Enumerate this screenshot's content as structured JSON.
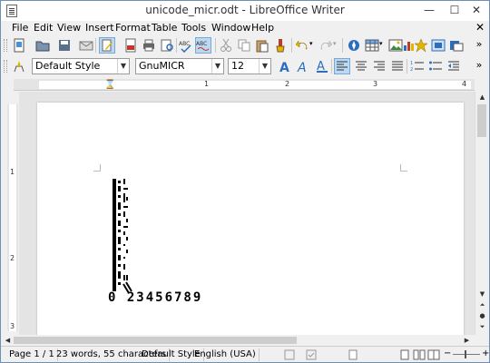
{
  "window": {
    "title": "unicode_micr.odt - LibreOffice Writer",
    "minimize_glyph": "—",
    "maximize_glyph": "☐",
    "close_glyph": "✕"
  },
  "menubar": {
    "items": [
      "File",
      "Edit",
      "View",
      "Insert",
      "Format",
      "Table",
      "Tools",
      "Window",
      "Help"
    ],
    "close_doc_glyph": "✕"
  },
  "formatting": {
    "paragraph_style": "Default Style",
    "font_name": "GnuMICR",
    "font_size": "12"
  },
  "ruler": {
    "horizontal_numbers": [
      "1",
      "2",
      "3",
      "4"
    ],
    "vertical_numbers": [
      "1",
      "2",
      "3"
    ]
  },
  "document": {
    "micr_digits": "0 23456789",
    "micr_symbols": [
      "⑆",
      "⑇",
      "⑈",
      "⑉"
    ]
  },
  "statusbar": {
    "page": "Page 1 / 1",
    "words": "23 words, 55 characters",
    "style": "Default Style",
    "language": "English (USA)"
  },
  "icons": {
    "accent_blue": "#2a6ebd",
    "accent_red": "#c0392b",
    "accent_yellow": "#e2b400"
  }
}
